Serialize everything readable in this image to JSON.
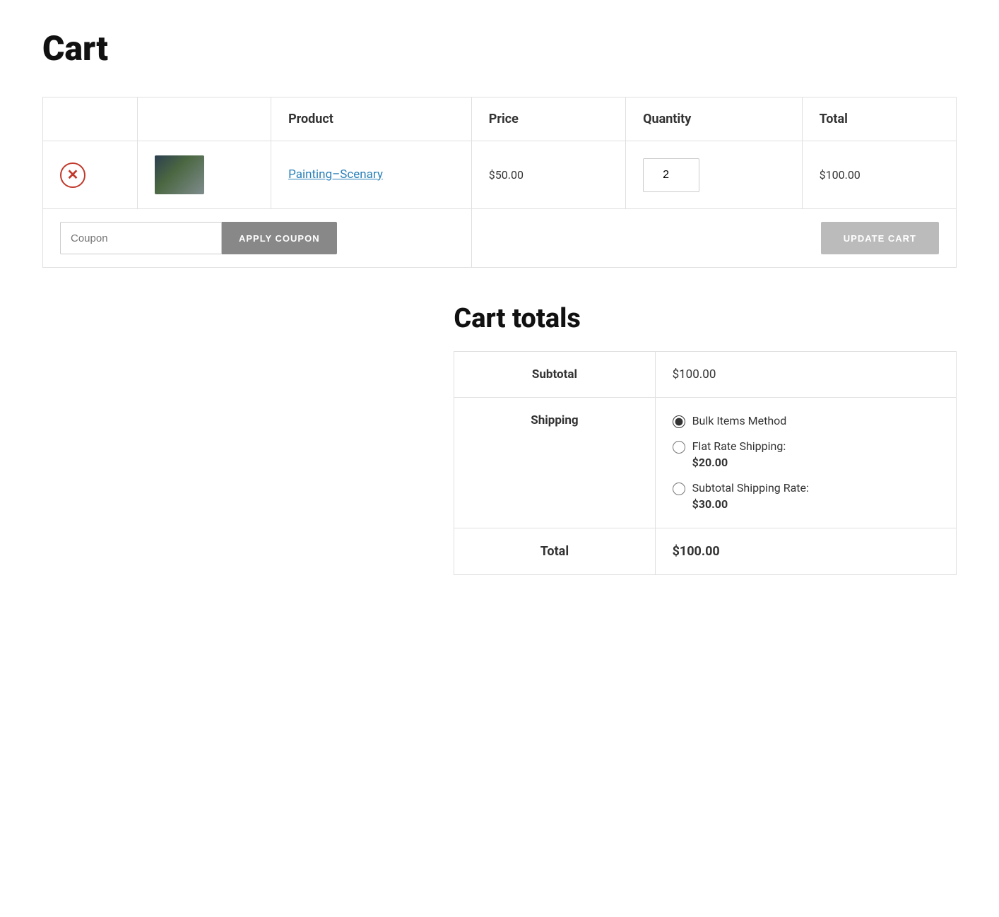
{
  "page": {
    "title": "Cart"
  },
  "cart": {
    "table": {
      "headers": {
        "remove": "",
        "image": "",
        "product": "Product",
        "price": "Price",
        "quantity": "Quantity",
        "total": "Total"
      },
      "items": [
        {
          "id": 1,
          "product_name": "Painting–Scenary",
          "product_url": "#",
          "price": "$50.00",
          "quantity": 2,
          "total": "$100.00"
        }
      ]
    },
    "coupon": {
      "placeholder": "Coupon",
      "apply_label": "APPLY COUPON",
      "update_label": "UPDATE CART"
    }
  },
  "cart_totals": {
    "title": "Cart totals",
    "subtotal_label": "Subtotal",
    "subtotal_value": "$100.00",
    "shipping_label": "Shipping",
    "shipping_options": [
      {
        "id": "bulk",
        "label": "Bulk Items Method",
        "checked": true,
        "detail": ""
      },
      {
        "id": "flat",
        "label": "Flat Rate Shipping:",
        "checked": false,
        "detail": "$20.00"
      },
      {
        "id": "subtotal",
        "label": "Subtotal Shipping Rate:",
        "checked": false,
        "detail": "$30.00"
      }
    ],
    "total_label": "Total",
    "total_value": "$100.00"
  }
}
